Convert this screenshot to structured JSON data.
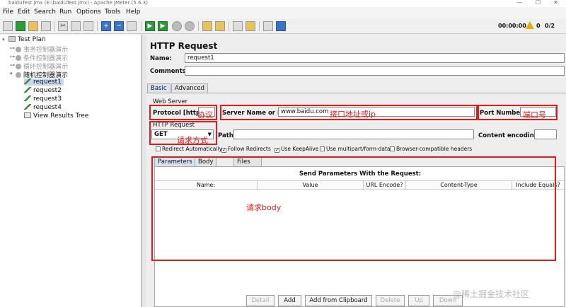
{
  "window": {
    "title": "baiduTest.jmx (E:\\baiduTest.jmx) - Apache JMeter (5.6.3)"
  },
  "menu": {
    "items": [
      "File",
      "Edit",
      "Search",
      "Run",
      "Options",
      "Tools",
      "Help"
    ]
  },
  "toolbar": {
    "timer": "00:00:00",
    "threads": "0",
    "counter": "0/2"
  },
  "tree": {
    "test_plan": "Test Plan",
    "controllers": [
      "事务控制器演示",
      "条件控制器演示",
      "循环控制器演示",
      "随机控制器演示"
    ],
    "requests": [
      "request1",
      "request2",
      "request3",
      "request4"
    ],
    "listener": "View Results Tree"
  },
  "panel": {
    "title": "HTTP Request",
    "name_label": "Name:",
    "name_value": "request1",
    "comments_label": "Comments:",
    "comments_value": "",
    "tabs": [
      "Basic",
      "Advanced"
    ],
    "web_server": "Web Server",
    "protocol_label": "Protocol [http]:",
    "server_label": "Server Name or IP:",
    "server_value": "www.baidu.com",
    "port_label": "Port Number:",
    "port_value": "",
    "http_request": "HTTP Request",
    "method": "GET",
    "path_label": "Path:",
    "path_value": "",
    "encoding_label": "Content encoding:",
    "encoding_value": "",
    "checkboxes": [
      {
        "label": "Redirect Automatically",
        "checked": false
      },
      {
        "label": "Follow Redirects",
        "checked": true
      },
      {
        "label": "Use KeepAlive",
        "checked": true
      },
      {
        "label": "Use multipart/form-data",
        "checked": false
      },
      {
        "label": "Browser-compatible headers",
        "checked": false
      }
    ],
    "subtabs": [
      "Parameters",
      "Body Data",
      "Files Upload"
    ],
    "params_caption": "Send Parameters With the Request:",
    "columns": [
      "Name:",
      "Value",
      "URL Encode?",
      "Content-Type",
      "Include Equals?"
    ],
    "buttons": [
      "Detail",
      "Add",
      "Add from Clipboard",
      "Delete",
      "Up",
      "Down"
    ]
  },
  "annotations": {
    "protocol": "协议",
    "server": "接口地址或ip",
    "port": "端口号",
    "method": "请求方式",
    "body": "请求body"
  },
  "watermark": "@稀土掘金技术社区",
  "colors": {
    "annotation": "#e01c1c",
    "selection": "#c7d8f0"
  }
}
